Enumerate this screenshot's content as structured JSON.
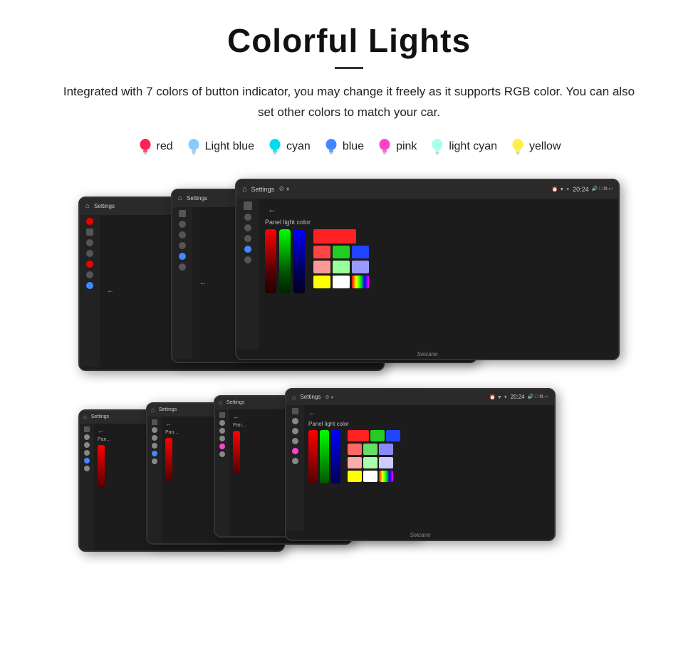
{
  "title": "Colorful Lights",
  "description": "Integrated with 7 colors of button indicator, you may change it freely as it supports RGB color. You can also set other colors to match your car.",
  "colors": [
    {
      "name": "red",
      "hex": "#ff2255",
      "label": "red"
    },
    {
      "name": "light-blue",
      "hex": "#88ccff",
      "label": "Light blue"
    },
    {
      "name": "cyan",
      "hex": "#00ddee",
      "label": "cyan"
    },
    {
      "name": "blue",
      "hex": "#4488ff",
      "label": "blue"
    },
    {
      "name": "pink",
      "hex": "#ff44cc",
      "label": "pink"
    },
    {
      "name": "light-cyan",
      "hex": "#aaffee",
      "label": "light cyan"
    },
    {
      "name": "yellow",
      "hex": "#ffee44",
      "label": "yellow"
    }
  ],
  "topbar_title": "Settings",
  "topbar_time": "20:24",
  "panel_light_label": "Panel light color",
  "watermark": "Seicane",
  "color_grid_rows": [
    [
      "#ff2222",
      "#22aa22",
      "#2222ff"
    ],
    [
      "#ff6666",
      "#66dd66",
      "#8888ff"
    ],
    [
      "#ffaaaa",
      "#aaffaa",
      "#ccccff"
    ],
    [
      "#ffff00",
      "#ffffff",
      "#ff44ff"
    ]
  ]
}
